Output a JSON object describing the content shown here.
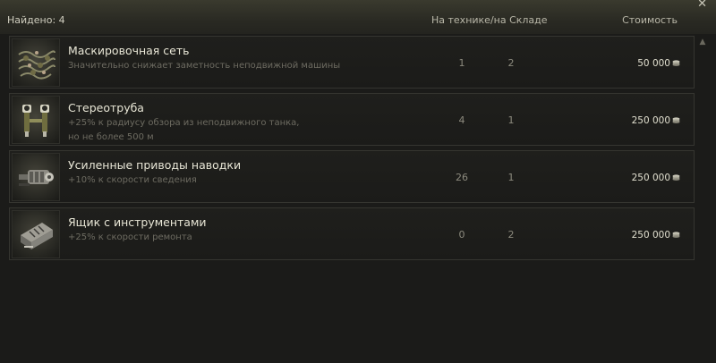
{
  "header": {
    "found_label": "Найдено: 4",
    "count_header": "На технике/на Складе",
    "price_header": "Стоимость"
  },
  "items": [
    {
      "title": "Маскировочная сеть",
      "desc_lines": [
        "Значительно снижает заметность неподвижной машины"
      ],
      "on_vehicle": "1",
      "in_depot": "2",
      "price": "50 000",
      "icon": "camouflage-net-icon"
    },
    {
      "title": "Стереотруба",
      "desc_lines": [
        "+25% к радиусу обзора из неподвижного танка,",
        "но не более 500 м"
      ],
      "on_vehicle": "4",
      "in_depot": "1",
      "price": "250 000",
      "icon": "binocular-periscope-icon"
    },
    {
      "title": "Усиленные приводы наводки",
      "desc_lines": [
        "+10% к скорости сведения"
      ],
      "on_vehicle": "26",
      "in_depot": "1",
      "price": "250 000",
      "icon": "gun-laying-drive-icon"
    },
    {
      "title": "Ящик с инструментами",
      "desc_lines": [
        "+25% к скорости ремонта"
      ],
      "on_vehicle": "0",
      "in_depot": "2",
      "price": "250 000",
      "icon": "toolbox-icon"
    }
  ],
  "colors": {
    "background": "#1b1b19",
    "title_text": "#e8e6d6",
    "desc_text": "#6d6b61"
  }
}
